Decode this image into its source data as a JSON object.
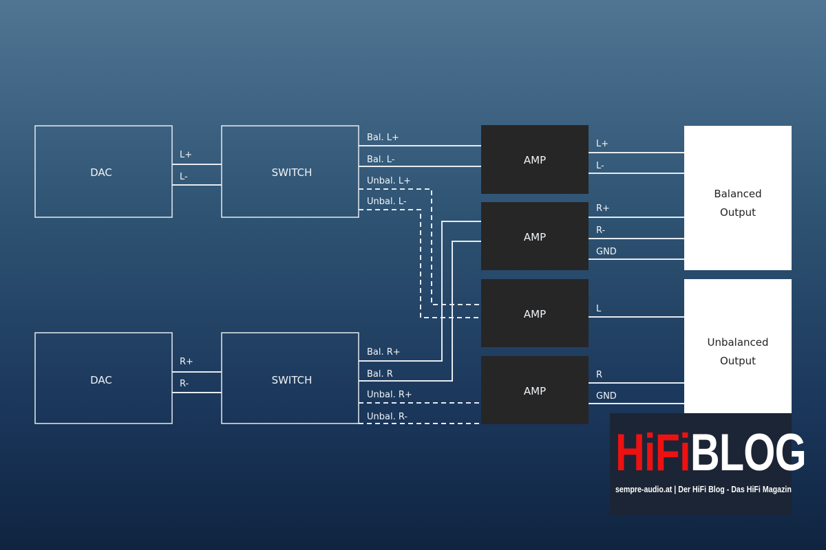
{
  "blocks": {
    "dac_top": "DAC",
    "switch_top": "SWITCH",
    "dac_bottom": "DAC",
    "switch_bottom": "SWITCH",
    "amps": [
      "AMP",
      "AMP",
      "AMP",
      "AMP"
    ],
    "balanced_output": [
      "Balanced",
      "Output"
    ],
    "unbalanced_output": [
      "Unbalanced",
      "Output"
    ]
  },
  "wires": {
    "dac_top": [
      "L+",
      "L-"
    ],
    "dac_bottom": [
      "R+",
      "R-"
    ],
    "switch_top": [
      "Bal. L+",
      "Bal. L-",
      "Unbal. L+",
      "Unbal. L-"
    ],
    "switch_bottom": [
      "Bal. R+",
      "Bal. R",
      "Unbal. R+",
      "Unbal. R-"
    ],
    "balanced_out": [
      "L+",
      "L-",
      "R+",
      "R-",
      "GND"
    ],
    "unbalanced_out": [
      "L",
      "R",
      "GND"
    ]
  },
  "colors": {
    "amp": "#262626",
    "output": "#ffffff",
    "logo_red": "#ee1111"
  },
  "logo": {
    "hifi": "HiFi",
    "blog": "BLOG",
    "tagline": "sempre-audio.at | Der HiFi Blog - Das HiFi Magazin"
  }
}
